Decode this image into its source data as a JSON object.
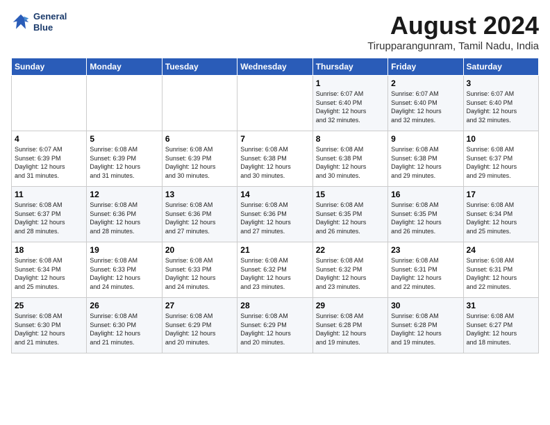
{
  "logo": {
    "line1": "General",
    "line2": "Blue"
  },
  "title": "August 2024",
  "location": "Tirupparangunram, Tamil Nadu, India",
  "weekdays": [
    "Sunday",
    "Monday",
    "Tuesday",
    "Wednesday",
    "Thursday",
    "Friday",
    "Saturday"
  ],
  "weeks": [
    [
      {
        "day": "",
        "info": ""
      },
      {
        "day": "",
        "info": ""
      },
      {
        "day": "",
        "info": ""
      },
      {
        "day": "",
        "info": ""
      },
      {
        "day": "1",
        "info": "Sunrise: 6:07 AM\nSunset: 6:40 PM\nDaylight: 12 hours\nand 32 minutes."
      },
      {
        "day": "2",
        "info": "Sunrise: 6:07 AM\nSunset: 6:40 PM\nDaylight: 12 hours\nand 32 minutes."
      },
      {
        "day": "3",
        "info": "Sunrise: 6:07 AM\nSunset: 6:40 PM\nDaylight: 12 hours\nand 32 minutes."
      }
    ],
    [
      {
        "day": "4",
        "info": "Sunrise: 6:07 AM\nSunset: 6:39 PM\nDaylight: 12 hours\nand 31 minutes."
      },
      {
        "day": "5",
        "info": "Sunrise: 6:08 AM\nSunset: 6:39 PM\nDaylight: 12 hours\nand 31 minutes."
      },
      {
        "day": "6",
        "info": "Sunrise: 6:08 AM\nSunset: 6:39 PM\nDaylight: 12 hours\nand 30 minutes."
      },
      {
        "day": "7",
        "info": "Sunrise: 6:08 AM\nSunset: 6:38 PM\nDaylight: 12 hours\nand 30 minutes."
      },
      {
        "day": "8",
        "info": "Sunrise: 6:08 AM\nSunset: 6:38 PM\nDaylight: 12 hours\nand 30 minutes."
      },
      {
        "day": "9",
        "info": "Sunrise: 6:08 AM\nSunset: 6:38 PM\nDaylight: 12 hours\nand 29 minutes."
      },
      {
        "day": "10",
        "info": "Sunrise: 6:08 AM\nSunset: 6:37 PM\nDaylight: 12 hours\nand 29 minutes."
      }
    ],
    [
      {
        "day": "11",
        "info": "Sunrise: 6:08 AM\nSunset: 6:37 PM\nDaylight: 12 hours\nand 28 minutes."
      },
      {
        "day": "12",
        "info": "Sunrise: 6:08 AM\nSunset: 6:36 PM\nDaylight: 12 hours\nand 28 minutes."
      },
      {
        "day": "13",
        "info": "Sunrise: 6:08 AM\nSunset: 6:36 PM\nDaylight: 12 hours\nand 27 minutes."
      },
      {
        "day": "14",
        "info": "Sunrise: 6:08 AM\nSunset: 6:36 PM\nDaylight: 12 hours\nand 27 minutes."
      },
      {
        "day": "15",
        "info": "Sunrise: 6:08 AM\nSunset: 6:35 PM\nDaylight: 12 hours\nand 26 minutes."
      },
      {
        "day": "16",
        "info": "Sunrise: 6:08 AM\nSunset: 6:35 PM\nDaylight: 12 hours\nand 26 minutes."
      },
      {
        "day": "17",
        "info": "Sunrise: 6:08 AM\nSunset: 6:34 PM\nDaylight: 12 hours\nand 25 minutes."
      }
    ],
    [
      {
        "day": "18",
        "info": "Sunrise: 6:08 AM\nSunset: 6:34 PM\nDaylight: 12 hours\nand 25 minutes."
      },
      {
        "day": "19",
        "info": "Sunrise: 6:08 AM\nSunset: 6:33 PM\nDaylight: 12 hours\nand 24 minutes."
      },
      {
        "day": "20",
        "info": "Sunrise: 6:08 AM\nSunset: 6:33 PM\nDaylight: 12 hours\nand 24 minutes."
      },
      {
        "day": "21",
        "info": "Sunrise: 6:08 AM\nSunset: 6:32 PM\nDaylight: 12 hours\nand 23 minutes."
      },
      {
        "day": "22",
        "info": "Sunrise: 6:08 AM\nSunset: 6:32 PM\nDaylight: 12 hours\nand 23 minutes."
      },
      {
        "day": "23",
        "info": "Sunrise: 6:08 AM\nSunset: 6:31 PM\nDaylight: 12 hours\nand 22 minutes."
      },
      {
        "day": "24",
        "info": "Sunrise: 6:08 AM\nSunset: 6:31 PM\nDaylight: 12 hours\nand 22 minutes."
      }
    ],
    [
      {
        "day": "25",
        "info": "Sunrise: 6:08 AM\nSunset: 6:30 PM\nDaylight: 12 hours\nand 21 minutes."
      },
      {
        "day": "26",
        "info": "Sunrise: 6:08 AM\nSunset: 6:30 PM\nDaylight: 12 hours\nand 21 minutes."
      },
      {
        "day": "27",
        "info": "Sunrise: 6:08 AM\nSunset: 6:29 PM\nDaylight: 12 hours\nand 20 minutes."
      },
      {
        "day": "28",
        "info": "Sunrise: 6:08 AM\nSunset: 6:29 PM\nDaylight: 12 hours\nand 20 minutes."
      },
      {
        "day": "29",
        "info": "Sunrise: 6:08 AM\nSunset: 6:28 PM\nDaylight: 12 hours\nand 19 minutes."
      },
      {
        "day": "30",
        "info": "Sunrise: 6:08 AM\nSunset: 6:28 PM\nDaylight: 12 hours\nand 19 minutes."
      },
      {
        "day": "31",
        "info": "Sunrise: 6:08 AM\nSunset: 6:27 PM\nDaylight: 12 hours\nand 18 minutes."
      }
    ]
  ]
}
